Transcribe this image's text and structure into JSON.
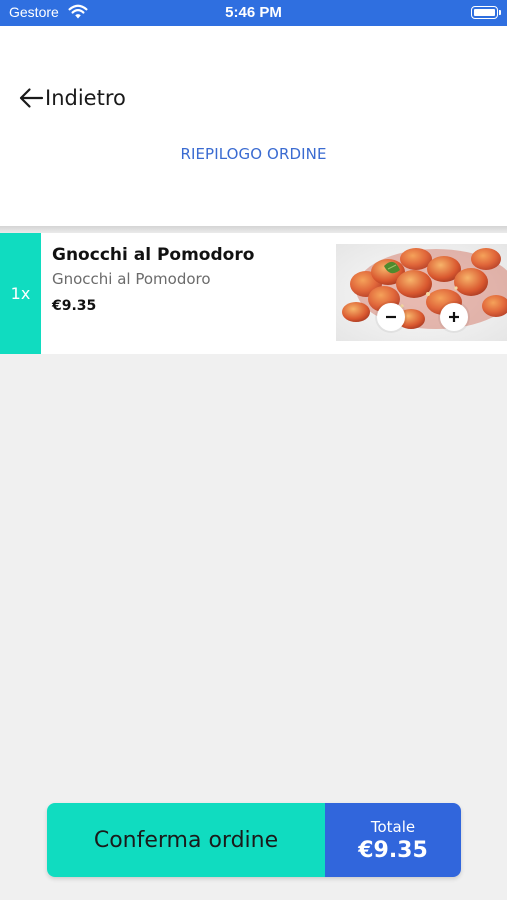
{
  "status_bar": {
    "carrier": "Gestore",
    "time": "5:46 PM"
  },
  "header": {
    "back_label": "Indietro",
    "title": "RIEPILOGO ORDINE"
  },
  "order": {
    "items": [
      {
        "quantity": "1x",
        "name": "Gnocchi al Pomodoro",
        "description": "Gnocchi al Pomodoro",
        "price": "€9.35"
      }
    ]
  },
  "footer": {
    "confirm_label": "Conferma ordine",
    "total_label": "Totale",
    "total_value": "€9.35"
  },
  "colors": {
    "accent_teal": "#10dcc0",
    "brand_blue": "#3166dc",
    "title_blue": "#3a6bd1"
  }
}
